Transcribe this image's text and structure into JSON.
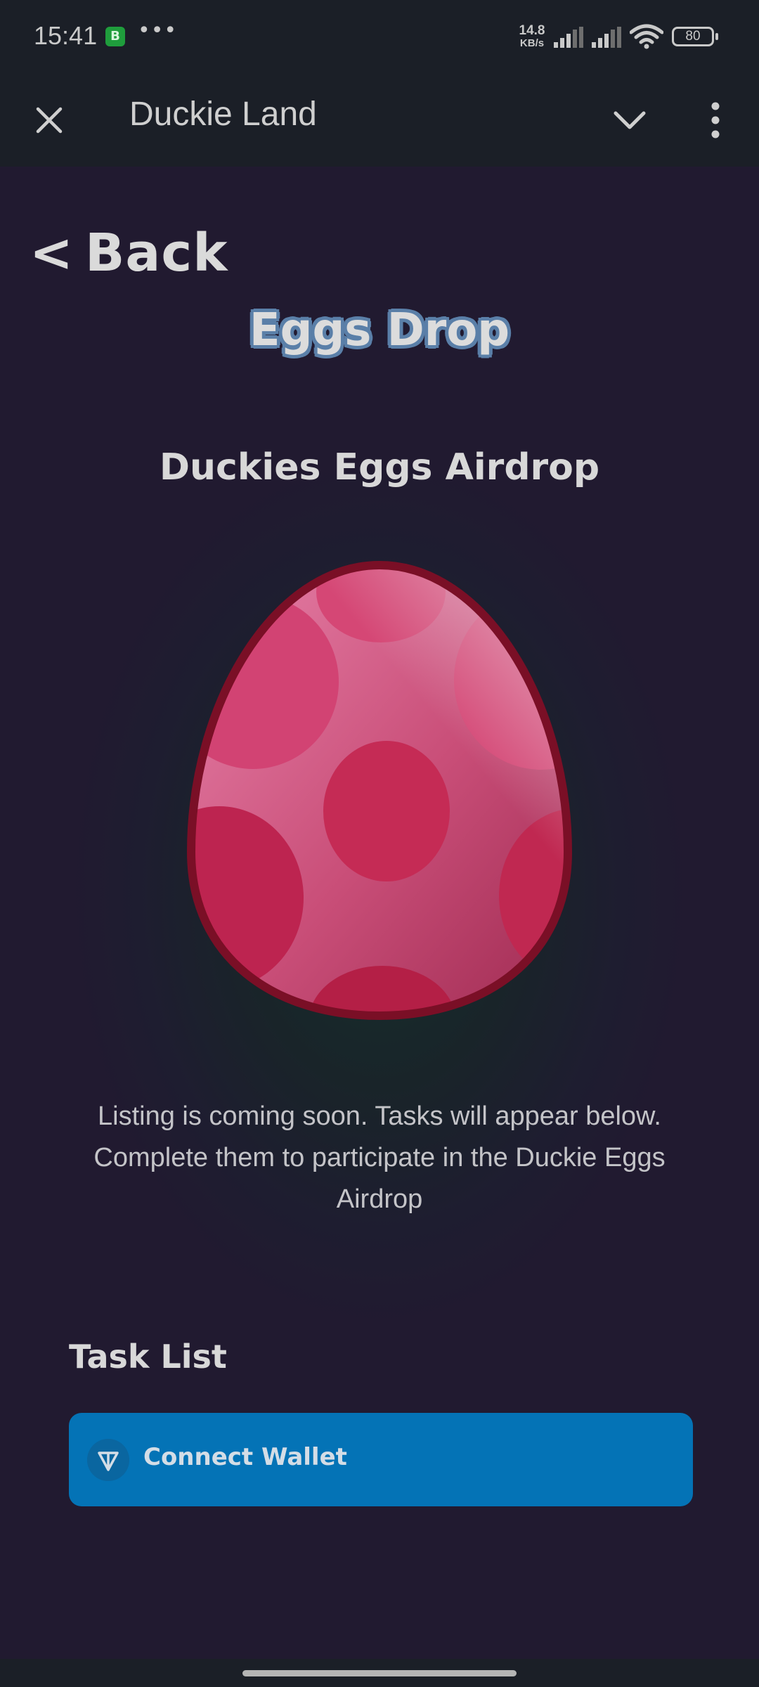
{
  "status_bar": {
    "time": "15:41",
    "notification_badge": "B",
    "more_dots": "•••",
    "net_speed_value": "14.8",
    "net_speed_unit": "KB/s",
    "battery": "80"
  },
  "header": {
    "title": "Duckie Land"
  },
  "page": {
    "back_label": "Back",
    "title": "Eggs Drop",
    "heading": "Duckies Eggs Airdrop",
    "description": "Listing is coming soon. Tasks will appear below. Complete them to participate in the Duckie Eggs Airdrop"
  },
  "tasks": {
    "heading": "Task List",
    "items": [
      {
        "label": "Connect Wallet",
        "icon": "ton-icon"
      }
    ]
  },
  "colors": {
    "background": "#1f1a2e",
    "bar_background": "#1b1f27",
    "task_button": "#0473b6",
    "egg_base": "#cc3f6d",
    "egg_outline": "#7a0f26",
    "title_outline": "#5a7fa8"
  }
}
